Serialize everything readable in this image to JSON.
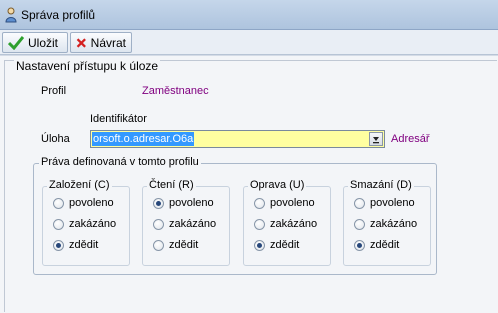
{
  "window": {
    "title": "Správa profilů",
    "icon": "person-icon"
  },
  "toolbar": {
    "save_label": "Uložit",
    "back_label": "Návrat"
  },
  "section": {
    "title": "Nastavení přístupu k úloze"
  },
  "profile": {
    "label": "Profil",
    "value": "Zaměstnanec"
  },
  "task": {
    "identifier_label": "Identifikátor",
    "label": "Úloha",
    "value": "orsoft.o.adresar.O6a",
    "link": "Adresář"
  },
  "rights": {
    "title": "Práva definovaná v tomto profilu",
    "groups": [
      {
        "title": "Založení (C)",
        "options": [
          "povoleno",
          "zakázáno",
          "zdědit"
        ],
        "selected": "zdědit"
      },
      {
        "title": "Čtení (R)",
        "options": [
          "povoleno",
          "zakázáno",
          "zdědit"
        ],
        "selected": "povoleno"
      },
      {
        "title": "Oprava (U)",
        "options": [
          "povoleno",
          "zakázáno",
          "zdědit"
        ],
        "selected": "zdědit"
      },
      {
        "title": "Smazání (D)",
        "options": [
          "povoleno",
          "zakázáno",
          "zdědit"
        ],
        "selected": "zdědit"
      }
    ]
  },
  "colors": {
    "link": "#800080",
    "highlight": "#3399ff",
    "input_bg": "#ffffa0",
    "titlebar": "#c5d6ea"
  }
}
